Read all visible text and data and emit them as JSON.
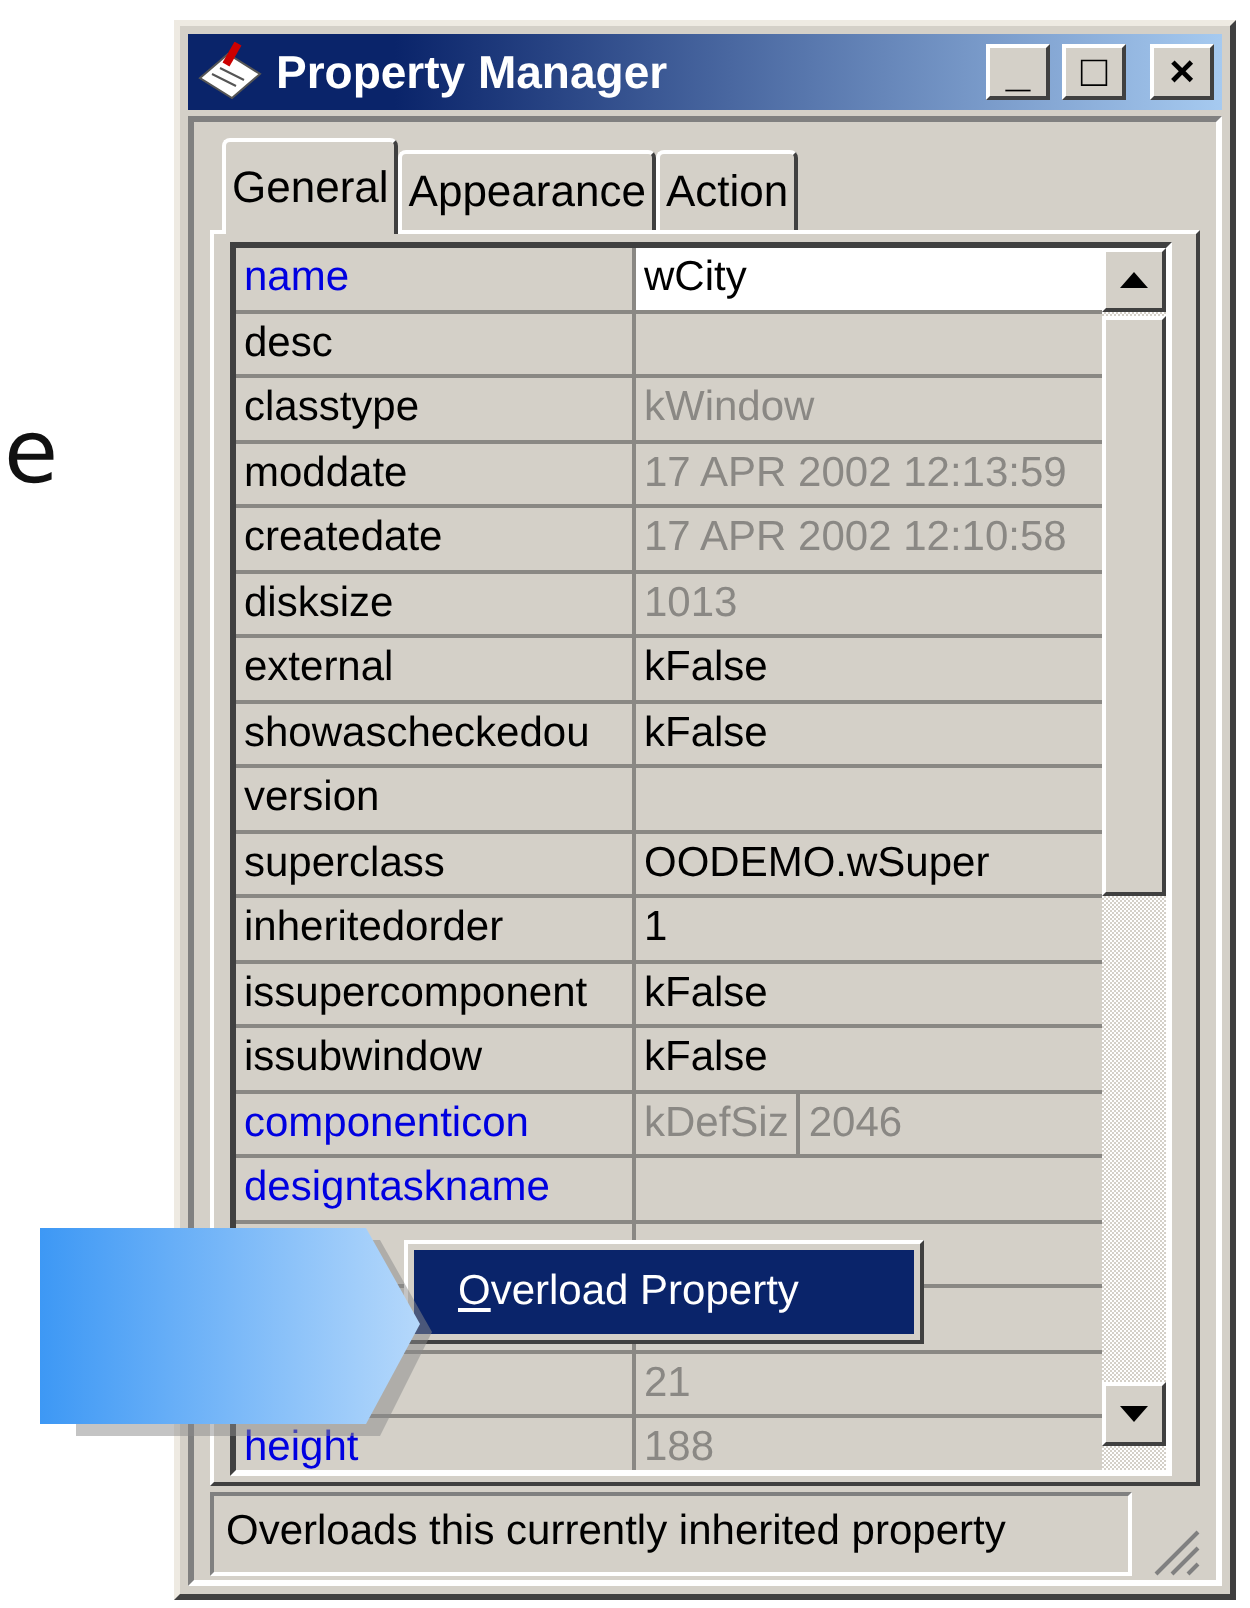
{
  "side_text": "e",
  "window": {
    "title": "Property Manager",
    "controls": [
      "_",
      "□",
      "×"
    ]
  },
  "tabs": [
    {
      "label": "General",
      "selected": true
    },
    {
      "label": "Appearance",
      "selected": false
    },
    {
      "label": "Action",
      "selected": false
    }
  ],
  "rows": [
    {
      "name": "name",
      "overloaded": true,
      "values": [
        "wCity"
      ],
      "readonly": false,
      "selected": true
    },
    {
      "name": "desc",
      "overloaded": false,
      "selected": false
    },
    {
      "name": "classtype",
      "overloaded": false,
      "values": [
        "kWindow"
      ],
      "readonly": true,
      "selected": false
    },
    {
      "name": "moddate",
      "overloaded": false,
      "values": [
        "17 APR 2002  12:13:59"
      ],
      "readonly": true,
      "selected": false
    },
    {
      "name": "createdate",
      "overloaded": false,
      "values": [
        "17 APR 2002  12:10:58"
      ],
      "readonly": true,
      "selected": false
    },
    {
      "name": "disksize",
      "overloaded": false,
      "values": [
        "1013"
      ],
      "readonly": true,
      "selected": false
    },
    {
      "name": "external",
      "overloaded": false,
      "values": [
        "kFalse"
      ],
      "readonly": false,
      "selected": false
    },
    {
      "name": "showascheckedou",
      "overloaded": false,
      "values": [
        "kFalse"
      ],
      "readonly": false,
      "selected": false
    },
    {
      "name": "version",
      "overloaded": false,
      "selected": false
    },
    {
      "name": "superclass",
      "overloaded": false,
      "values": [
        "OODEMO.wSuper"
      ],
      "readonly": false,
      "selected": false
    },
    {
      "name": "inheritedorder",
      "overloaded": false,
      "values": [
        "1"
      ],
      "readonly": false,
      "selected": false
    },
    {
      "name": "issupercomponent",
      "overloaded": false,
      "values": [
        "kFalse"
      ],
      "readonly": false,
      "selected": false
    },
    {
      "name": "issubwindow",
      "overloaded": false,
      "values": [
        "kFalse"
      ],
      "readonly": false,
      "selected": false
    },
    {
      "name": "componenticon",
      "overloaded": true,
      "values": [
        "kDefSiz",
        "2046"
      ],
      "readonly": true,
      "selected": false
    },
    {
      "name": "designtaskname",
      "overloaded": true,
      "selected": false
    },
    {
      "selected": false
    },
    {
      "selected": false
    },
    {
      "values": [
        "21"
      ],
      "readonly": true,
      "selected": false
    },
    {
      "name": "height",
      "overloaded": true,
      "values": [
        "188"
      ],
      "readonly": true,
      "selected": false
    }
  ],
  "context_menu": {
    "label": "Overload Property"
  },
  "status_bar": "Overloads this currently inherited property"
}
